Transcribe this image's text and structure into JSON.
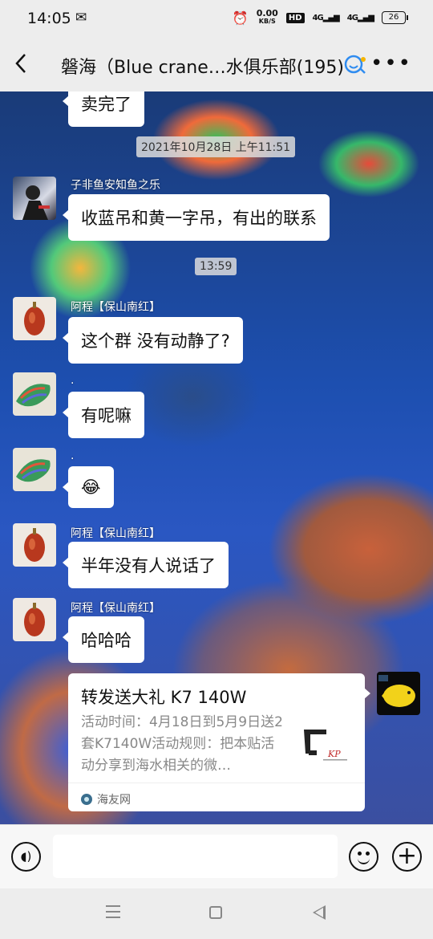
{
  "status_bar": {
    "time": "14:05",
    "wechat_icon": "wechat-icon",
    "netspeed_value": "0.00",
    "netspeed_unit": "KB/S",
    "hd": "HD",
    "signal1": "4G",
    "signal2": "4G",
    "battery": "26"
  },
  "header": {
    "title": "磐海（Blue crane…水俱乐部(195)",
    "back_icon": "chevron-left-icon",
    "more_icon": "more-icon"
  },
  "messages": {
    "m0": "卖完了",
    "ts1": "2021年10月28日 上午11:51",
    "n1": "子非鱼安知鱼之乐",
    "m1": "收蓝吊和黄一字吊，有出的联系",
    "ts2": "13:59",
    "n2": "阿程【保山南红】",
    "m2": "这个群 没有动静了?",
    "n3": ".",
    "m3": "有呢嘛",
    "n4": ".",
    "m4": "😂",
    "n5": "阿程【保山南红】",
    "m5": "半年没有人说话了",
    "n6": "阿程【保山南红】",
    "m6": "哈哈哈"
  },
  "card": {
    "title": "转发送大礼 K7 140W",
    "desc": "活动时间：4月18日到5月9日送2套K7140W活动规则：把本贴活动分享到海水相关的微…",
    "source": "海友网"
  },
  "colors": {
    "bubble": "#ffffff",
    "timestamp_bg": "#dcdcdc",
    "bar_bg": "#ededed"
  }
}
